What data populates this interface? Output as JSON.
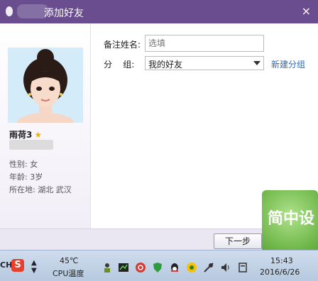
{
  "window": {
    "title": "添加好友",
    "close_label": "×"
  },
  "profile": {
    "name": "雨荷3",
    "gender": "性别: 女",
    "age": "年龄: 3岁",
    "location": "所在地: 湖北  武汉"
  },
  "form": {
    "remark_label": "备注姓名:",
    "remark_placeholder": "选填",
    "group_label": "分    组:",
    "group_value": "我的好友",
    "new_group_link": "新建分组"
  },
  "footer": {
    "next_button": "下一步"
  },
  "watermark": {
    "text": "简中设"
  },
  "taskbar": {
    "lang": "CH",
    "ime": "S",
    "temperature": "45℃",
    "cpu_label": "CPU温度",
    "time": "15:43",
    "date": "2016/6/26"
  },
  "colors": {
    "titlebar": "#6a4d8e",
    "link": "#2a6bb4",
    "star": "#f0b400"
  }
}
